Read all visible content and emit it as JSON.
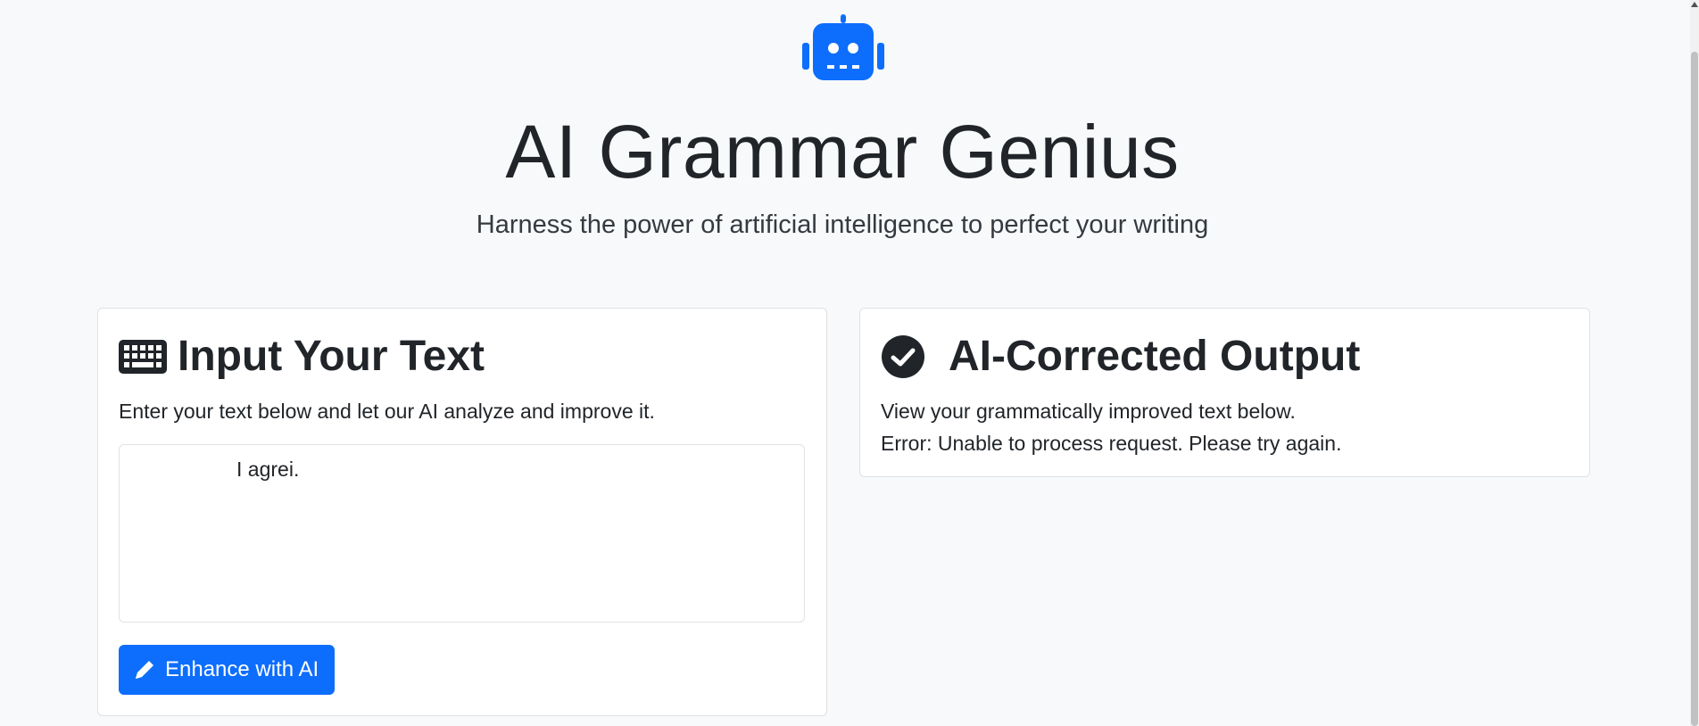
{
  "header": {
    "logo_icon": "robot-icon",
    "title": "AI Grammar Genius",
    "subtitle": "Harness the power of artificial intelligence to perfect your writing"
  },
  "input_card": {
    "icon": "keyboard-icon",
    "heading": "Input Your Text",
    "description": "Enter your text below and let our AI analyze and improve it.",
    "textarea_value": "                  I agrei.",
    "button_icon": "pencil-icon",
    "button_label": "Enhance with AI"
  },
  "output_card": {
    "icon": "check-circle-icon",
    "heading": "AI-Corrected Output",
    "description": "View your grammatically improved text below.",
    "error": "Error: Unable to process request. Please try again."
  },
  "colors": {
    "primary": "#0d6efd",
    "background": "#f8f9fa",
    "text": "#212529"
  }
}
